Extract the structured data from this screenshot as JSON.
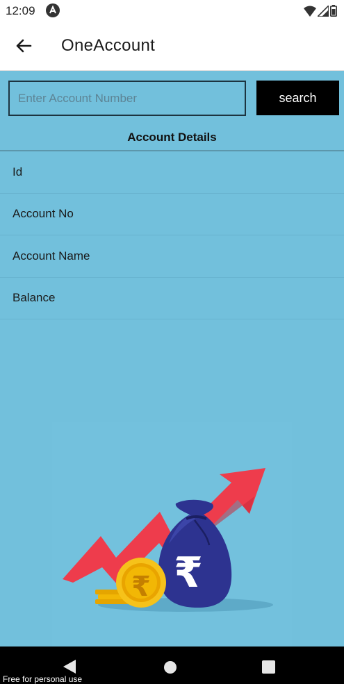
{
  "status_bar": {
    "time": "12:09"
  },
  "app_bar": {
    "title": "OneAccount"
  },
  "search": {
    "placeholder": "Enter Account Number",
    "value": "",
    "button_label": "search"
  },
  "details": {
    "title": "Account Details",
    "rows": [
      "Id",
      "Account No",
      "Account Name",
      "Balance"
    ]
  },
  "illustration": {
    "symbol": "₹",
    "icon": "money-growth-illustration"
  },
  "watermark": "Free for personal use",
  "colors": {
    "background": "#72c0dc",
    "button": "#000000",
    "arrow": "#ee3c4c",
    "bag": "#2d3390",
    "coin": "#f2b705"
  }
}
